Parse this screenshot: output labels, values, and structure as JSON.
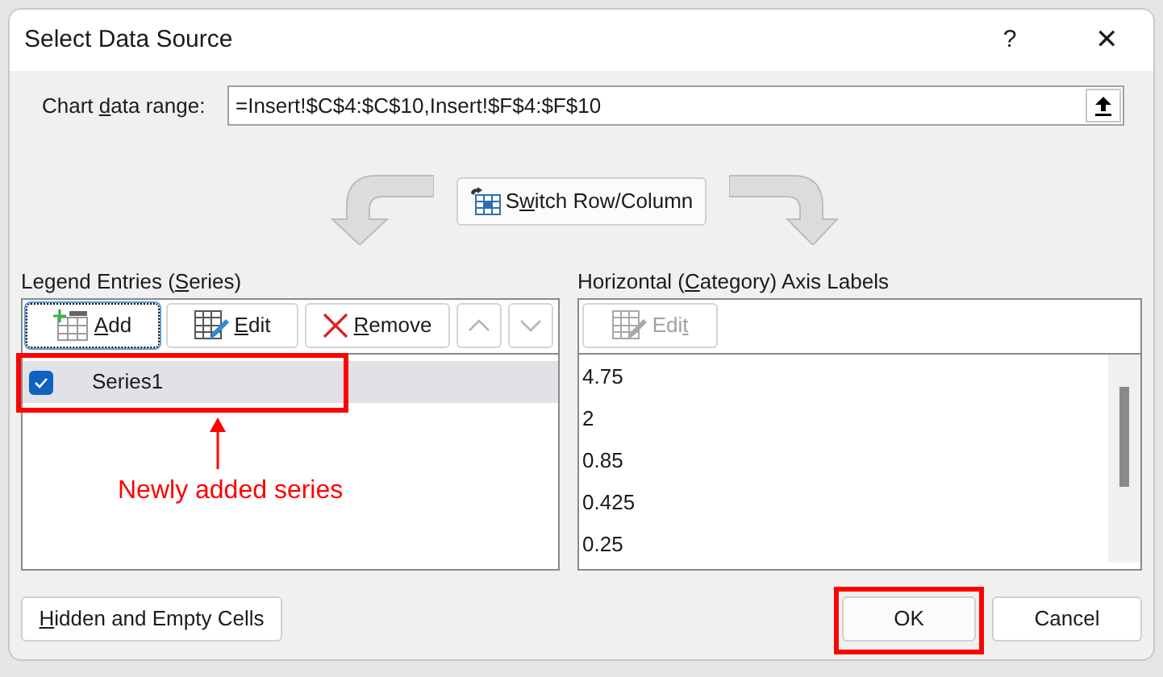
{
  "window": {
    "title": "Select Data Source",
    "help": "?",
    "close": "✕"
  },
  "data_range": {
    "label_parts": [
      {
        "text": "Chart ",
        "underlined": false
      },
      {
        "text": "d",
        "underlined": true
      },
      {
        "text": "ata range:",
        "underlined": false
      }
    ],
    "value": "=Insert!$C$4:$C$10,Insert!$F$4:$F$10"
  },
  "switch_button": {
    "label_parts": [
      {
        "text": "S",
        "underlined": false
      },
      {
        "text": "w",
        "underlined": true
      },
      {
        "text": "itch Row/Column",
        "underlined": false
      }
    ]
  },
  "legend": {
    "label_parts": [
      {
        "text": "Legend Entries (",
        "underlined": false
      },
      {
        "text": "S",
        "underlined": true
      },
      {
        "text": "eries)",
        "underlined": false
      }
    ],
    "toolbar": [
      {
        "kind": "add",
        "label_parts": [
          {
            "text": "A",
            "underlined": true
          },
          {
            "text": "dd",
            "underlined": false
          }
        ],
        "disabled": false,
        "focused": true
      },
      {
        "kind": "edit",
        "label_parts": [
          {
            "text": "E",
            "underlined": true
          },
          {
            "text": "dit",
            "underlined": false
          }
        ],
        "disabled": false,
        "focused": false
      },
      {
        "kind": "remove",
        "label_parts": [
          {
            "text": "R",
            "underlined": true
          },
          {
            "text": "emove",
            "underlined": false
          }
        ],
        "disabled": false,
        "focused": false
      },
      {
        "kind": "up",
        "disabled": true,
        "focused": false
      },
      {
        "kind": "down",
        "disabled": true,
        "focused": false
      }
    ],
    "series": [
      {
        "name": "Series1",
        "checked": true,
        "selected": true
      }
    ]
  },
  "annotation": {
    "text": "Newly added series"
  },
  "axis": {
    "label_parts": [
      {
        "text": "Horizontal (",
        "underlined": false
      },
      {
        "text": "C",
        "underlined": true
      },
      {
        "text": "ategory) Axis Labels",
        "underlined": false
      }
    ],
    "toolbar": [
      {
        "kind": "edit",
        "label_parts": [
          {
            "text": "Edi",
            "underlined": false
          },
          {
            "text": "t",
            "underlined": true
          }
        ],
        "disabled": true,
        "focused": false
      }
    ],
    "items": [
      "4.75",
      "2",
      "0.85",
      "0.425",
      "0.25"
    ]
  },
  "footer": {
    "hidden_button": {
      "label_parts": [
        {
          "text": "H",
          "underlined": true
        },
        {
          "text": "idden and Empty Cells",
          "underlined": false
        }
      ]
    },
    "ok": {
      "label": "OK",
      "highlighted": true
    },
    "cancel": {
      "label": "Cancel"
    }
  }
}
